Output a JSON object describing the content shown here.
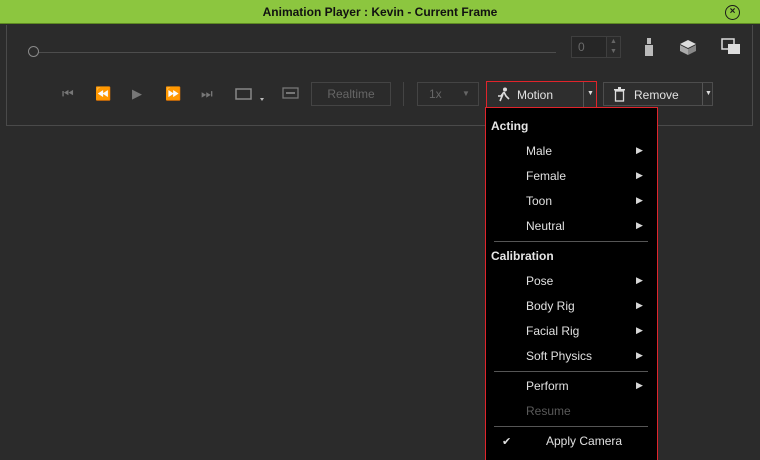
{
  "window": {
    "title": "Animation Player : Kevin - Current Frame",
    "close_icon": "close-icon"
  },
  "player": {
    "frame_value": "0",
    "realtime_label": "Realtime",
    "speed_value": "1x",
    "motion_label": "Motion",
    "remove_label": "Remove"
  },
  "menu": {
    "acting_header": "Acting",
    "acting_items": [
      "Male",
      "Female",
      "Toon",
      "Neutral"
    ],
    "calibration_header": "Calibration",
    "calibration_items": [
      "Pose",
      "Body Rig",
      "Facial Rig",
      "Soft Physics"
    ],
    "perform_label": "Perform",
    "resume_label": "Resume",
    "apply_camera_label": "Apply Camera",
    "apply_camera_checked": true
  },
  "colors": {
    "titlebar": "#8cc63f",
    "highlight_border": "#e0242b",
    "background": "#2b2b2b"
  }
}
